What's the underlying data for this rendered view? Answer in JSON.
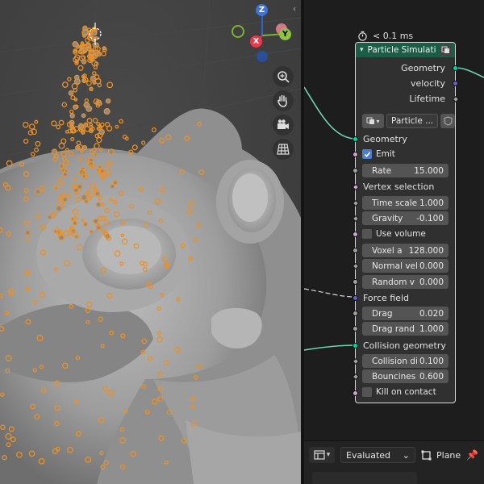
{
  "node_editor": {
    "timing": "< 0.1 ms",
    "node": {
      "title": "Particle Simulation",
      "outputs": [
        "Geometry",
        "velocity",
        "Lifetime"
      ],
      "cache_name": "Particle ...",
      "inputs": {
        "geometry": "Geometry",
        "emit": "Emit",
        "emit_checked": true,
        "rate_label": "Rate",
        "rate_value": "15.000",
        "vertex_selection": "Vertex selection",
        "time_scale_label": "Time scale",
        "time_scale_value": "1.000",
        "gravity_label": "Gravity",
        "gravity_value": "-0.100",
        "use_volume": "Use volume",
        "use_volume_checked": false,
        "voxel_label": "Voxel a",
        "voxel_value": "128.000",
        "normal_vel_label": "Normal vel",
        "normal_vel_value": "0.000",
        "random_v_label": "Random v",
        "random_v_value": "0.000",
        "force_field": "Force field",
        "drag_label": "Drag",
        "drag_value": "0.020",
        "drag_rand_label": "Drag rand",
        "drag_rand_value": "1.000",
        "collision_geometry": "Collision geometry",
        "collision_di_label": "Collision di",
        "collision_di_value": "0.100",
        "bounciness_label": "Bouncines",
        "bounciness_value": "0.600",
        "kill_on_contact": "Kill on contact",
        "kill_checked": false
      }
    }
  },
  "bottom_bar": {
    "mode_select": "Evaluated",
    "object_name": "Plane"
  },
  "viewport": {
    "gizmo_axes": [
      "Z",
      "X",
      "Y"
    ],
    "nav_tools": [
      "zoom-icon",
      "hand-pan-icon",
      "camera-icon",
      "grid-icon"
    ]
  },
  "colors": {
    "node_header": "#1b5d47",
    "geometry_socket": "#00d6a3",
    "particles": "#e8912a",
    "mesh": "#9a9a9a"
  }
}
